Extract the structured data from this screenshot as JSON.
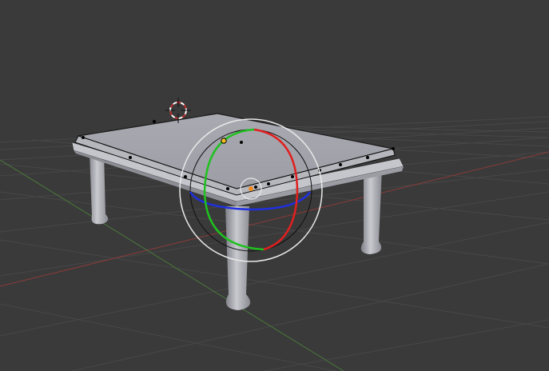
{
  "viewport": {
    "background": "#3a3a3a",
    "grid_color": "#474747",
    "x_axis_color": "#8a3a3a",
    "y_axis_color": "#4a7a3a"
  },
  "object": {
    "type": "table",
    "color": "#a7a7ae",
    "selected_edge_color": "#000000"
  },
  "rotate_gizmo": {
    "x_ring_color": "#e02020",
    "y_ring_color": "#20c020",
    "z_ring_color": "#2030e0",
    "view_ring_color": "#e8e8e8",
    "trackball_ring_color": "#101010",
    "pivot_color": "#f08a20"
  },
  "cursor_3d": {
    "icon": "3d-cursor-icon",
    "ring_colors": [
      "#c03030",
      "#ffffff"
    ]
  }
}
